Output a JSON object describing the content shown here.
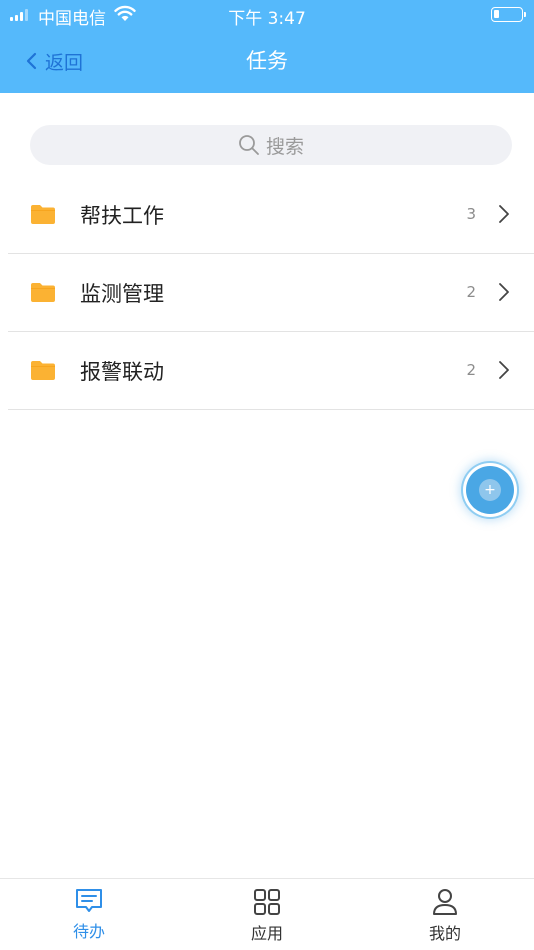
{
  "status_bar": {
    "carrier": "中国电信",
    "time": "下午 3:47"
  },
  "nav": {
    "back_label": "返回",
    "title": "任务"
  },
  "search": {
    "placeholder": "搜索"
  },
  "tasks": [
    {
      "label": "帮扶工作",
      "count": "3"
    },
    {
      "label": "监测管理",
      "count": "2"
    },
    {
      "label": "报警联动",
      "count": "2"
    }
  ],
  "tabbar": {
    "items": [
      {
        "label": "待办",
        "icon": "message-icon",
        "active": true
      },
      {
        "label": "应用",
        "icon": "grid-icon",
        "active": false
      },
      {
        "label": "我的",
        "icon": "user-icon",
        "active": false
      }
    ]
  },
  "colors": {
    "header": "#55b9fb",
    "back_link": "#1f73d6",
    "folder": "#fbb233",
    "tab_active": "#2f8fe8",
    "fab": "#4aa7e5"
  }
}
